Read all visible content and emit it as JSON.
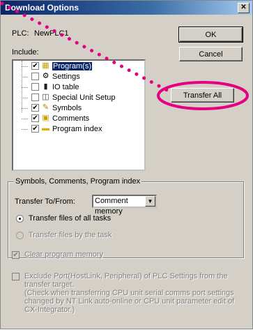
{
  "window": {
    "title": "Download Options",
    "close_glyph": "✕"
  },
  "plc": {
    "label": "PLC:",
    "name": "NewPLC1"
  },
  "include_label": "Include:",
  "buttons": {
    "ok": "OK",
    "cancel": "Cancel",
    "transfer_all": "Transfer All"
  },
  "tree": [
    {
      "label": "Program(s)",
      "checked": true,
      "icon": "program-icon"
    },
    {
      "label": "Settings",
      "checked": false,
      "icon": "settings-icon"
    },
    {
      "label": "IO table",
      "checked": false,
      "icon": "io-table-icon"
    },
    {
      "label": "Special Unit Setup",
      "checked": false,
      "icon": "special-unit-icon"
    },
    {
      "label": "Symbols",
      "checked": true,
      "icon": "symbols-icon"
    },
    {
      "label": "Comments",
      "checked": true,
      "icon": "comments-icon"
    },
    {
      "label": "Program index",
      "checked": true,
      "icon": "program-index-icon"
    }
  ],
  "group": {
    "title": "Symbols, Comments, Program index",
    "transfer_label": "Transfer To/From:",
    "transfer_value": "Comment memory",
    "radio_all": "Transfer files of all tasks",
    "radio_task": "Transfer files by the task"
  },
  "clear_memory": "Clear program memory",
  "exclude_text": "Exclude Port(HostLink, Peripheral) of PLC Settings from the transfer target.\n(Check when transferring CPU unit serial comms port settings changed by NT Link auto-online or CPU unit parameter edit of CX-Integrator.)",
  "colors": {
    "annotation": "#e4007f",
    "title_start": "#0a246a",
    "title_end": "#a6caf0"
  }
}
